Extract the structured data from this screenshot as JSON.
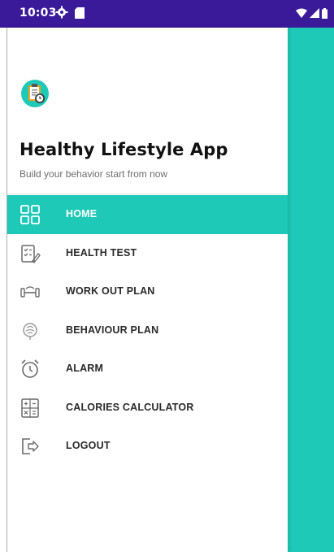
{
  "status_bar": {
    "time": "10:03",
    "icons": [
      "gear-icon",
      "sd-card-icon",
      "wifi-icon",
      "signal-icon",
      "battery-icon"
    ]
  },
  "colors": {
    "accent": "#1ec9b8",
    "status_bar": "#3b1a9a",
    "drawer_bg": "#ffffff",
    "text_dark": "#2a2a2a"
  },
  "header": {
    "logo_icon": "health-clipboard-icon",
    "title": "Healthy Lifestyle App",
    "subtitle": "Build your behavior start from now"
  },
  "menu": {
    "items": [
      {
        "label": "HOME",
        "icon": "grid-icon",
        "active": true
      },
      {
        "label": "HEALTH TEST",
        "icon": "checklist-icon",
        "active": false
      },
      {
        "label": "WORK OUT PLAN",
        "icon": "dumbbell-icon",
        "active": false
      },
      {
        "label": "BEHAVIOUR PLAN",
        "icon": "brain-icon",
        "active": false
      },
      {
        "label": "ALARM",
        "icon": "alarm-clock-icon",
        "active": false
      },
      {
        "label": "CALORIES CALCULATOR",
        "icon": "calculator-icon",
        "active": false
      },
      {
        "label": "LOGOUT",
        "icon": "logout-icon",
        "active": false
      }
    ]
  }
}
